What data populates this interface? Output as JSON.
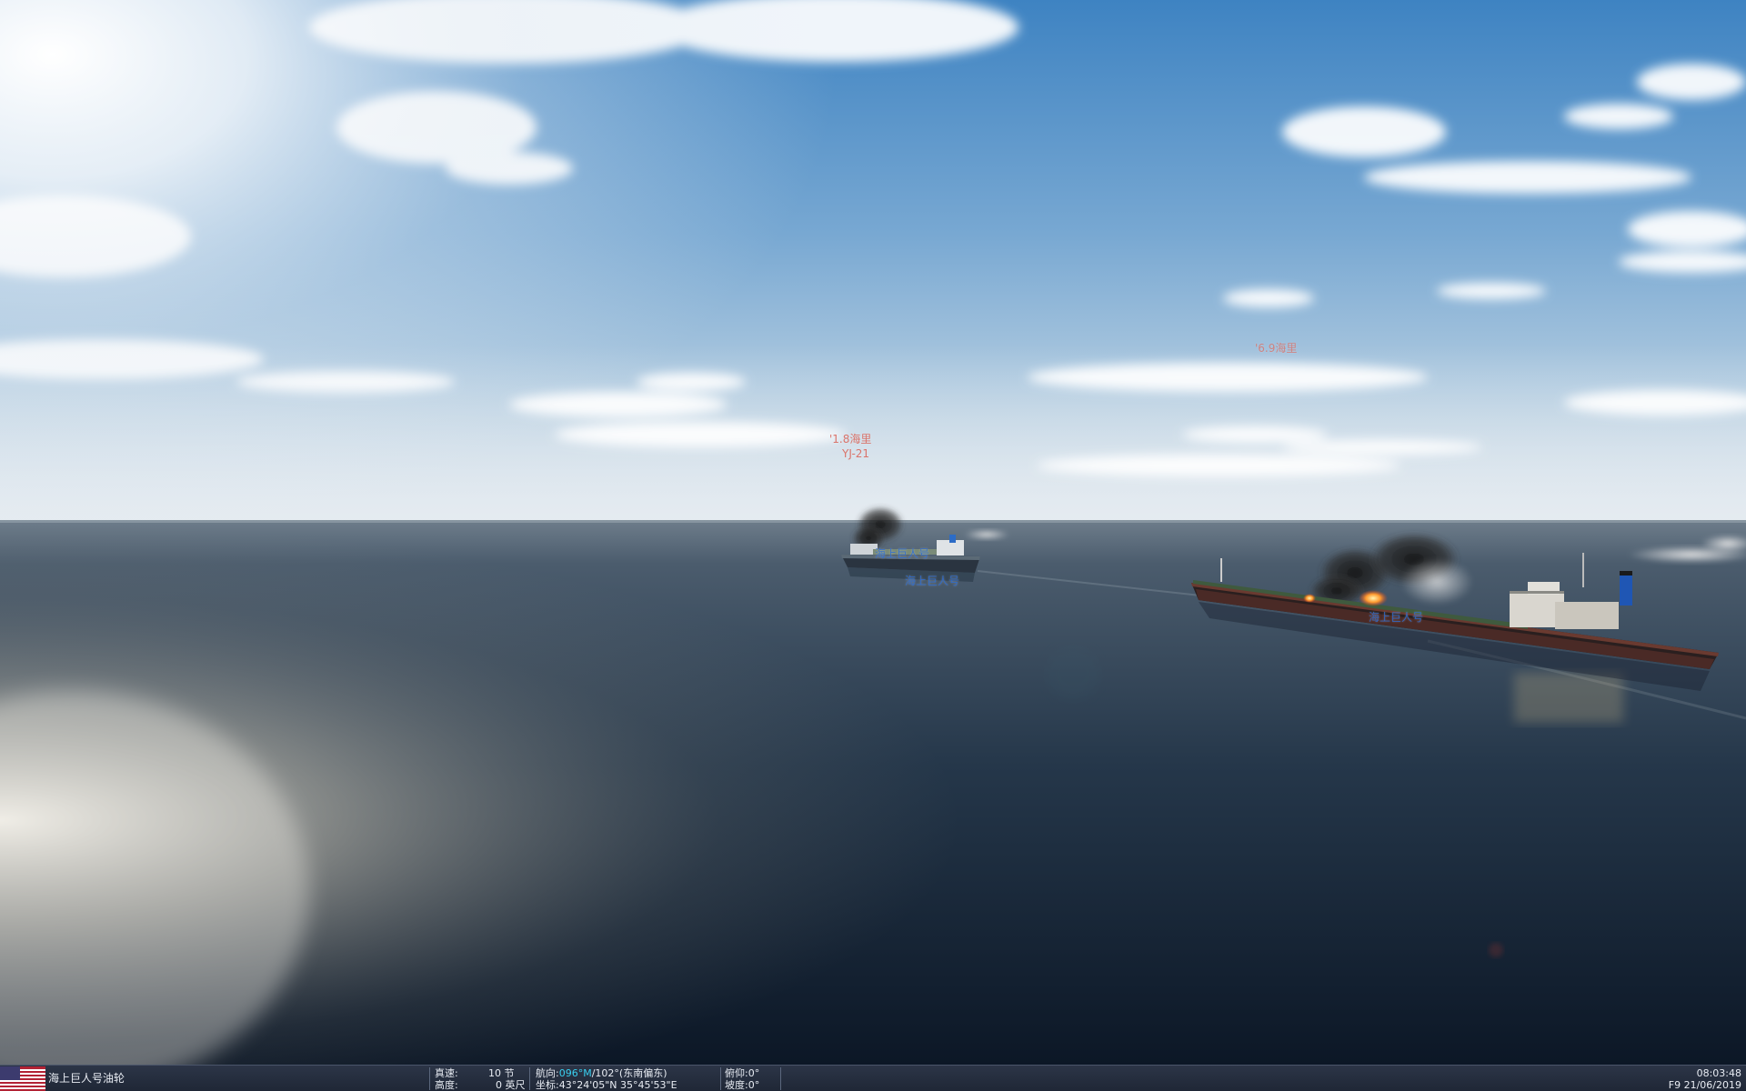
{
  "scene": {
    "sky_top": "#3f84c1",
    "sky_horizon": "#cfdde8",
    "sea_far": "#4d5f70",
    "sea_near": "#0f1b2a"
  },
  "overlays": {
    "missile_range": "'1.8海里",
    "missile_name": "YJ-21",
    "far_contact_range": "'6.9海里",
    "ship_left_label_a": "海上巨人号",
    "ship_left_label_b": "海上巨人号",
    "ship_right_label": "海上巨人号"
  },
  "status": {
    "unit_name": "海上巨人号油轮",
    "flag_icon": "us-flag-icon",
    "speed_label": "真速:",
    "speed_value": "10 节",
    "altitude_label": "高度:",
    "altitude_value": "0 英尺",
    "heading_label": "航向:",
    "heading_value": "096°M",
    "heading_rest": "/102°(东南偏东)",
    "coords_label": "坐标:",
    "coords_value": "43°24'05\"N 35°45'53\"E",
    "pitch_label": "俯仰:",
    "pitch_value": "0°",
    "slope_label": "坡度:",
    "slope_value": "0°",
    "time": "08:03:48",
    "date": "F9 21/06/2019",
    "accent_color": "#39d0f0"
  }
}
